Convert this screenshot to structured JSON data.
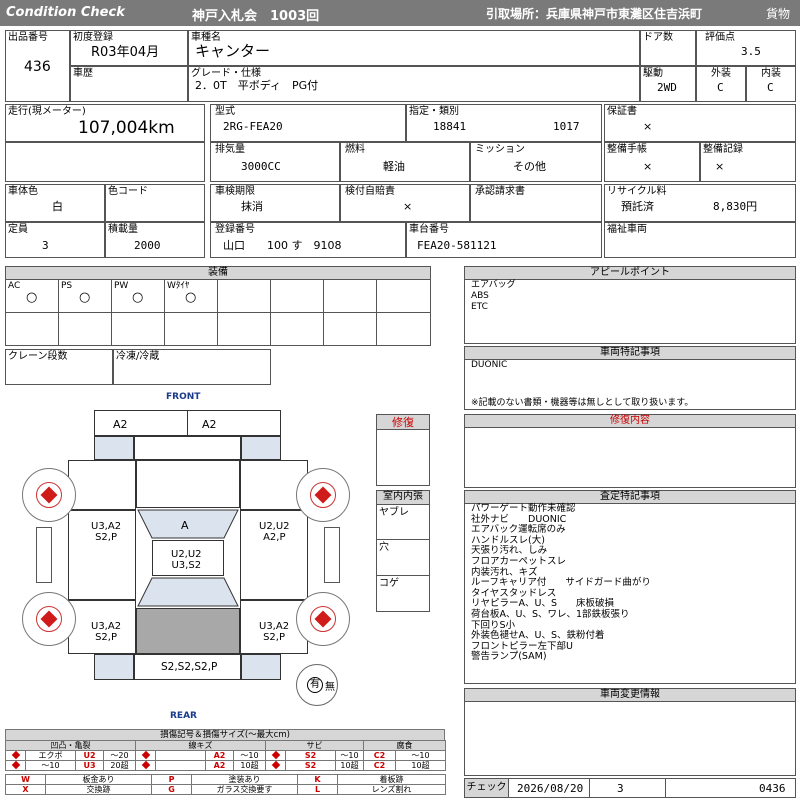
{
  "header": {
    "left_title": "Condition  Check",
    "auction": "神戸入札会　1003回",
    "pickup": "引取場所：兵庫県神戸市東灘区住吉浜町",
    "category": "貨物"
  },
  "row1": {
    "lot_label": "出品番号",
    "lot": "436",
    "first_reg_label": "初度登録",
    "first_reg": "R03年04月",
    "name_label": "車種名",
    "name": "キャンター",
    "doors_label": "ドア数",
    "doors": "",
    "score_label": "評価点",
    "score": "3.5",
    "history_label": "車歴",
    "history": "",
    "grade_label": "グレード・仕様",
    "grade": "2．0T　平ボディ　PG付",
    "drive_label": "駆動",
    "drive": "2WD",
    "ext_label": "外装",
    "ext": "C",
    "int_label": "内装",
    "int": "C"
  },
  "row2": {
    "mileage_label": "走行(現メーター)",
    "mileage": "107,004km",
    "model_label": "型式",
    "model": "2RG-FEA20",
    "designation_label": "指定・類別",
    "designation": "18841",
    "category_no": "1017",
    "warranty_label": "保証書",
    "warranty": "×",
    "displacement_label": "排気量",
    "displacement": "3000CC",
    "fuel_label": "燃料",
    "fuel": "軽油",
    "mission_label": "ミッション",
    "mission": "その他",
    "maint_label": "整備手帳",
    "maint": "×",
    "record_label": "整備記録",
    "record": "×"
  },
  "row3": {
    "color_label": "車体色",
    "color": "白",
    "color_code_label": "色コード",
    "color_code": "",
    "inspection_label": "車検期限",
    "inspection": "抹消",
    "self_check_label": "検付自賠責",
    "self_check": "×",
    "approval_label": "承認請求書",
    "approval": "",
    "recycle_label": "リサイクル料",
    "recycle_status": "預託済",
    "recycle_fee": "8,830円",
    "capacity_label": "定員",
    "capacity": "3",
    "load_label": "積載量",
    "load": "2000",
    "plate_label": "登録番号",
    "plate": "山口　　100 す　9108",
    "chassis_label": "車台番号",
    "chassis": "FEA20-581121",
    "welfare_label": "福祉車両",
    "welfare": ""
  },
  "equipment": {
    "title": "装備",
    "items": [
      {
        "label": "AC",
        "mark": "○"
      },
      {
        "label": "PS",
        "mark": "○"
      },
      {
        "label": "PW",
        "mark": "○"
      },
      {
        "label": "Wﾀｲﾔ",
        "mark": "○"
      }
    ],
    "crane_label": "クレーン段数",
    "freezer_label": "冷凍/冷蔵"
  },
  "appeal": {
    "title": "アピールポイント",
    "text": "エアバッグ\nABS\nETC"
  },
  "special": {
    "title": "車両特記事項",
    "text": "DUONIC",
    "note": "※記載のない書類・機器等は無しとして取り扱います。"
  },
  "repair_title": "修復",
  "repair_content_title": "修復内容",
  "inspection_notes": {
    "title": "査定特記事項",
    "text": "パワーゲート動作未確認\n社外ナビ　　DUONIC\nエアバック運転席のみ\nハンドルスレ(大)\n天張り汚れ、しみ\nフロアカーペットスレ\n内装汚れ、キズ\nルーフキャリア付　　サイドガード曲がり\nタイヤスタッドレス\nリヤピラーA、U、S　　床板破損\n荷台板A、U、S、ワレ、1部鉄板張り\n下回りS小\n外装色褪せA、U、S、鉄粉付着\nフロントピラー左下部U\n警告ランプ(SAM)"
  },
  "change_info": {
    "title": "車両変更情報"
  },
  "interior_box": {
    "title": "室内内張",
    "items": [
      "ヤブレ",
      "穴",
      "コゲ"
    ]
  },
  "diagram": {
    "front": "FRONT",
    "rear": "REAR",
    "marks": {
      "front_left": "A2",
      "front_right": "A2",
      "hood": "A",
      "roof": "U2,U2\nU3,S2",
      "left_front": "U3,A2\nS2,P",
      "right_front": "U2,U2\nA2,P",
      "left_rear": "U3,A2\nS2,P",
      "right_rear": "U3,A2\nS2,P",
      "rear": "S2,S2,S2,P"
    },
    "spare": "有",
    "spare_none": "無"
  },
  "legend": {
    "title": "損傷記号＆損傷サイズ(〜最大cm)",
    "groups": [
      {
        "name": "凹凸・亀裂",
        "a": "エクボ",
        "a2": "U2",
        "a3": "〜20",
        "b": "〜10",
        "b2": "U3",
        "b3": "20超"
      },
      {
        "name": "線キズ",
        "a2": "A2",
        "a3": "〜10",
        "b2": "A2",
        "b3": "10超"
      },
      {
        "name": "サビ",
        "a2": "S2",
        "a3": "〜10",
        "b2": "S2",
        "b3": "10超"
      },
      {
        "name": "腐食",
        "a2": "C2",
        "a3": "〜10",
        "b2": "C2",
        "b3": "10超"
      }
    ],
    "codes": [
      [
        "W",
        "板金あり",
        "P",
        "塗装あり",
        "K",
        "着板跡"
      ],
      [
        "X",
        "交換跡",
        "G",
        "ガラス交換要す",
        "L",
        "レンズ割れ"
      ]
    ]
  },
  "footer": {
    "check_label": "チェック",
    "date": "2026/08/20",
    "num": "3",
    "id": "0436"
  }
}
